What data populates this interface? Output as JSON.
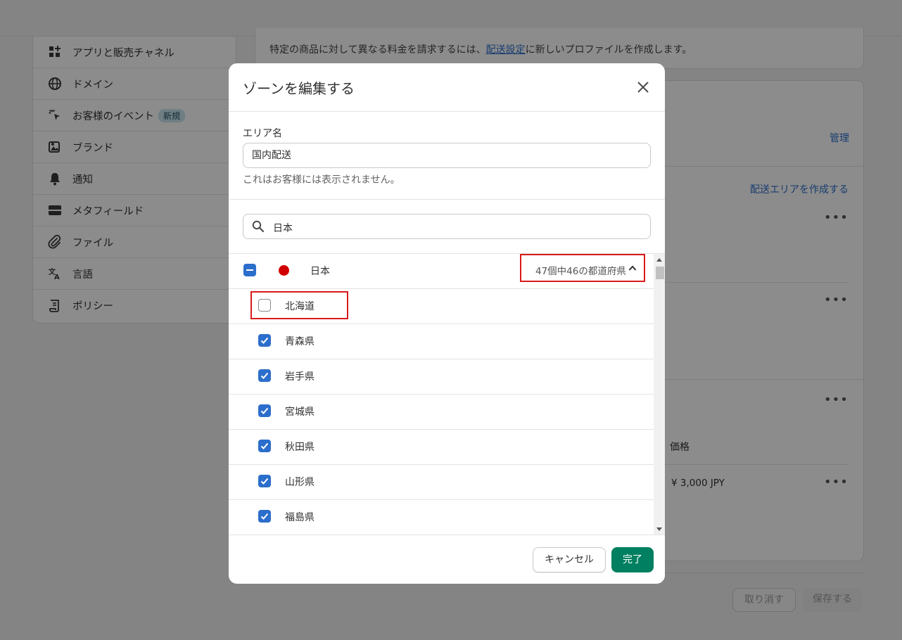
{
  "sidebar": {
    "items": [
      {
        "label": "アプリと販売チャネル",
        "icon": "apps-icon"
      },
      {
        "label": "ドメイン",
        "icon": "globe-icon"
      },
      {
        "label": "お客様のイベント",
        "icon": "cursor-sparkle-icon",
        "badge": "新規"
      },
      {
        "label": "ブランド",
        "icon": "brand-icon"
      },
      {
        "label": "通知",
        "icon": "bell-icon"
      },
      {
        "label": "メタフィールド",
        "icon": "metafield-icon"
      },
      {
        "label": "ファイル",
        "icon": "paperclip-icon"
      },
      {
        "label": "言語",
        "icon": "translate-icon"
      },
      {
        "label": "ポリシー",
        "icon": "policy-icon"
      }
    ]
  },
  "main": {
    "info_text_before": "特定の商品に対して異なる料金を請求するには、",
    "info_link": "配送設定",
    "info_text_after": "に新しいプロファイルを作成します。",
    "manage_link": "管理",
    "create_zone_link": "配送エリアを作成する",
    "price_header": "価格",
    "price_value": "¥ 3,000 JPY",
    "undo_button": "取り消す",
    "save_button": "保存する"
  },
  "modal": {
    "title": "ゾーンを編集する",
    "area_label": "エリア名",
    "area_value": "国内配送",
    "help_text": "これはお客様には表示されません。",
    "search_value": "日本",
    "country": {
      "name": "日本",
      "count_text": "47個中46の都道府県",
      "state": "indeterminate"
    },
    "prefectures": [
      {
        "name": "北海道",
        "checked": false
      },
      {
        "name": "青森県",
        "checked": true
      },
      {
        "name": "岩手県",
        "checked": true
      },
      {
        "name": "宮城県",
        "checked": true
      },
      {
        "name": "秋田県",
        "checked": true
      },
      {
        "name": "山形県",
        "checked": true
      },
      {
        "name": "福島県",
        "checked": true
      }
    ],
    "cancel_button": "キャンセル",
    "done_button": "完了"
  },
  "colors": {
    "accent_blue": "#2c6ecb",
    "primary_green": "#008060",
    "highlight_red": "#d91a1a",
    "flag_red": "#d10000"
  }
}
